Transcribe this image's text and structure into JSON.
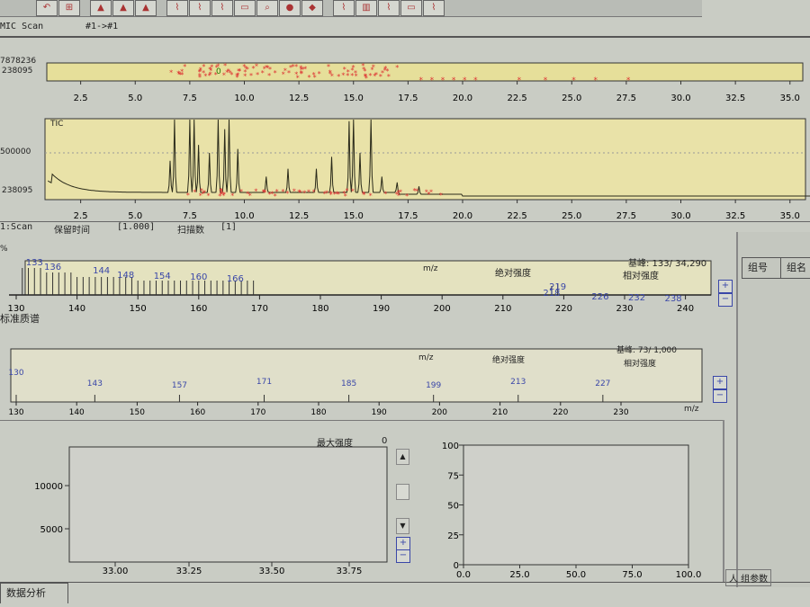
{
  "toolbar": {
    "buttons": [
      "zoom-back",
      "zoom-all",
      "chrom-1",
      "chrom-2",
      "chrom-3",
      "peak-pick-1",
      "peak-pick-2",
      "peak-pick-3",
      "annotate",
      "search",
      "point",
      "color",
      "integrate-1",
      "integrate-2",
      "integrate-3",
      "integrate-4",
      "integrate-5"
    ]
  },
  "overview": {
    "title": "MIC Scan",
    "range": "#1->#1",
    "y_max": "7878236",
    "y_min": "238095",
    "marker": "0",
    "x_ticks": [
      "2.5",
      "5.0",
      "7.5",
      "10.0",
      "12.5",
      "15.0",
      "17.5",
      "20.0",
      "22.5",
      "25.0",
      "27.5",
      "30.0",
      "32.5",
      "35.0"
    ]
  },
  "tic": {
    "label": "TIC",
    "y_ticks": [
      "500000",
      "238095"
    ],
    "x_ticks": [
      "2.5",
      "5.0",
      "7.5",
      "10.0",
      "12.5",
      "15.0",
      "17.5",
      "20.0",
      "22.5",
      "25.0",
      "27.5",
      "30.0",
      "32.5",
      "35.0"
    ],
    "peaks": [
      [
        6.6,
        0.4
      ],
      [
        6.8,
        0.95
      ],
      [
        7.5,
        1.0
      ],
      [
        7.7,
        1.0
      ],
      [
        7.9,
        0.6
      ],
      [
        8.4,
        0.5
      ],
      [
        8.8,
        1.0
      ],
      [
        9.1,
        0.8
      ],
      [
        9.3,
        1.0
      ],
      [
        9.7,
        0.55
      ],
      [
        11.0,
        0.2
      ],
      [
        12.0,
        0.3
      ],
      [
        13.3,
        0.3
      ],
      [
        14.0,
        0.45
      ],
      [
        14.8,
        0.9
      ],
      [
        15.0,
        1.0
      ],
      [
        15.3,
        0.5
      ],
      [
        15.8,
        1.0
      ],
      [
        16.3,
        0.2
      ],
      [
        17.0,
        0.15
      ],
      [
        18.0,
        0.1
      ]
    ]
  },
  "scan_info": {
    "scan": "1:Scan",
    "rt_label": "保留时间",
    "rt_value": "[1.000]",
    "scan_no_label": "扫描数",
    "scan_no_value": "[1]"
  },
  "spectrum": {
    "y_unit": "%",
    "base_peak": "基峰: 133/ 34,290",
    "mz_label": "m/z",
    "abs_label": "绝对强度",
    "rel_label": "相对强度",
    "x_ticks": [
      "130",
      "140",
      "150",
      "160",
      "170",
      "180",
      "190",
      "200",
      "210",
      "220",
      "230",
      "240"
    ],
    "peak_labels": [
      "133",
      "136",
      "144",
      "148",
      "154",
      "160",
      "166",
      "218",
      "219",
      "226",
      "232",
      "238"
    ],
    "lines_from": 131,
    "lines_to": 169
  },
  "library": {
    "title": "标准质谱",
    "base_peak": "基峰: 73/  1,000",
    "mz_label": "m/z",
    "abs_label": "绝对强度",
    "rel_label": "相对强度",
    "x_ticks": [
      "130",
      "140",
      "150",
      "160",
      "170",
      "180",
      "190",
      "200",
      "210",
      "220",
      "230"
    ],
    "axis_unit": "m/z",
    "peak_labels": [
      "130",
      "143",
      "157",
      "171",
      "185",
      "199",
      "213",
      "227"
    ]
  },
  "right_panel": {
    "columns": [
      "组号",
      "组名"
    ],
    "bottom_tab": "人 组参数"
  },
  "chrom_zoom": {
    "max_label": "最大强度",
    "max_value": "0",
    "y_ticks": [
      "10000",
      "5000"
    ],
    "x_ticks": [
      "33.00",
      "33.25",
      "33.50",
      "33.75"
    ]
  },
  "similarity_plot": {
    "y_ticks": [
      "100",
      "75",
      "50",
      "25",
      "0"
    ],
    "x_ticks": [
      "0.0",
      "25.0",
      "50.0",
      "75.0",
      "100.0"
    ]
  },
  "tabs": {
    "data_analysis": "数据分析"
  }
}
